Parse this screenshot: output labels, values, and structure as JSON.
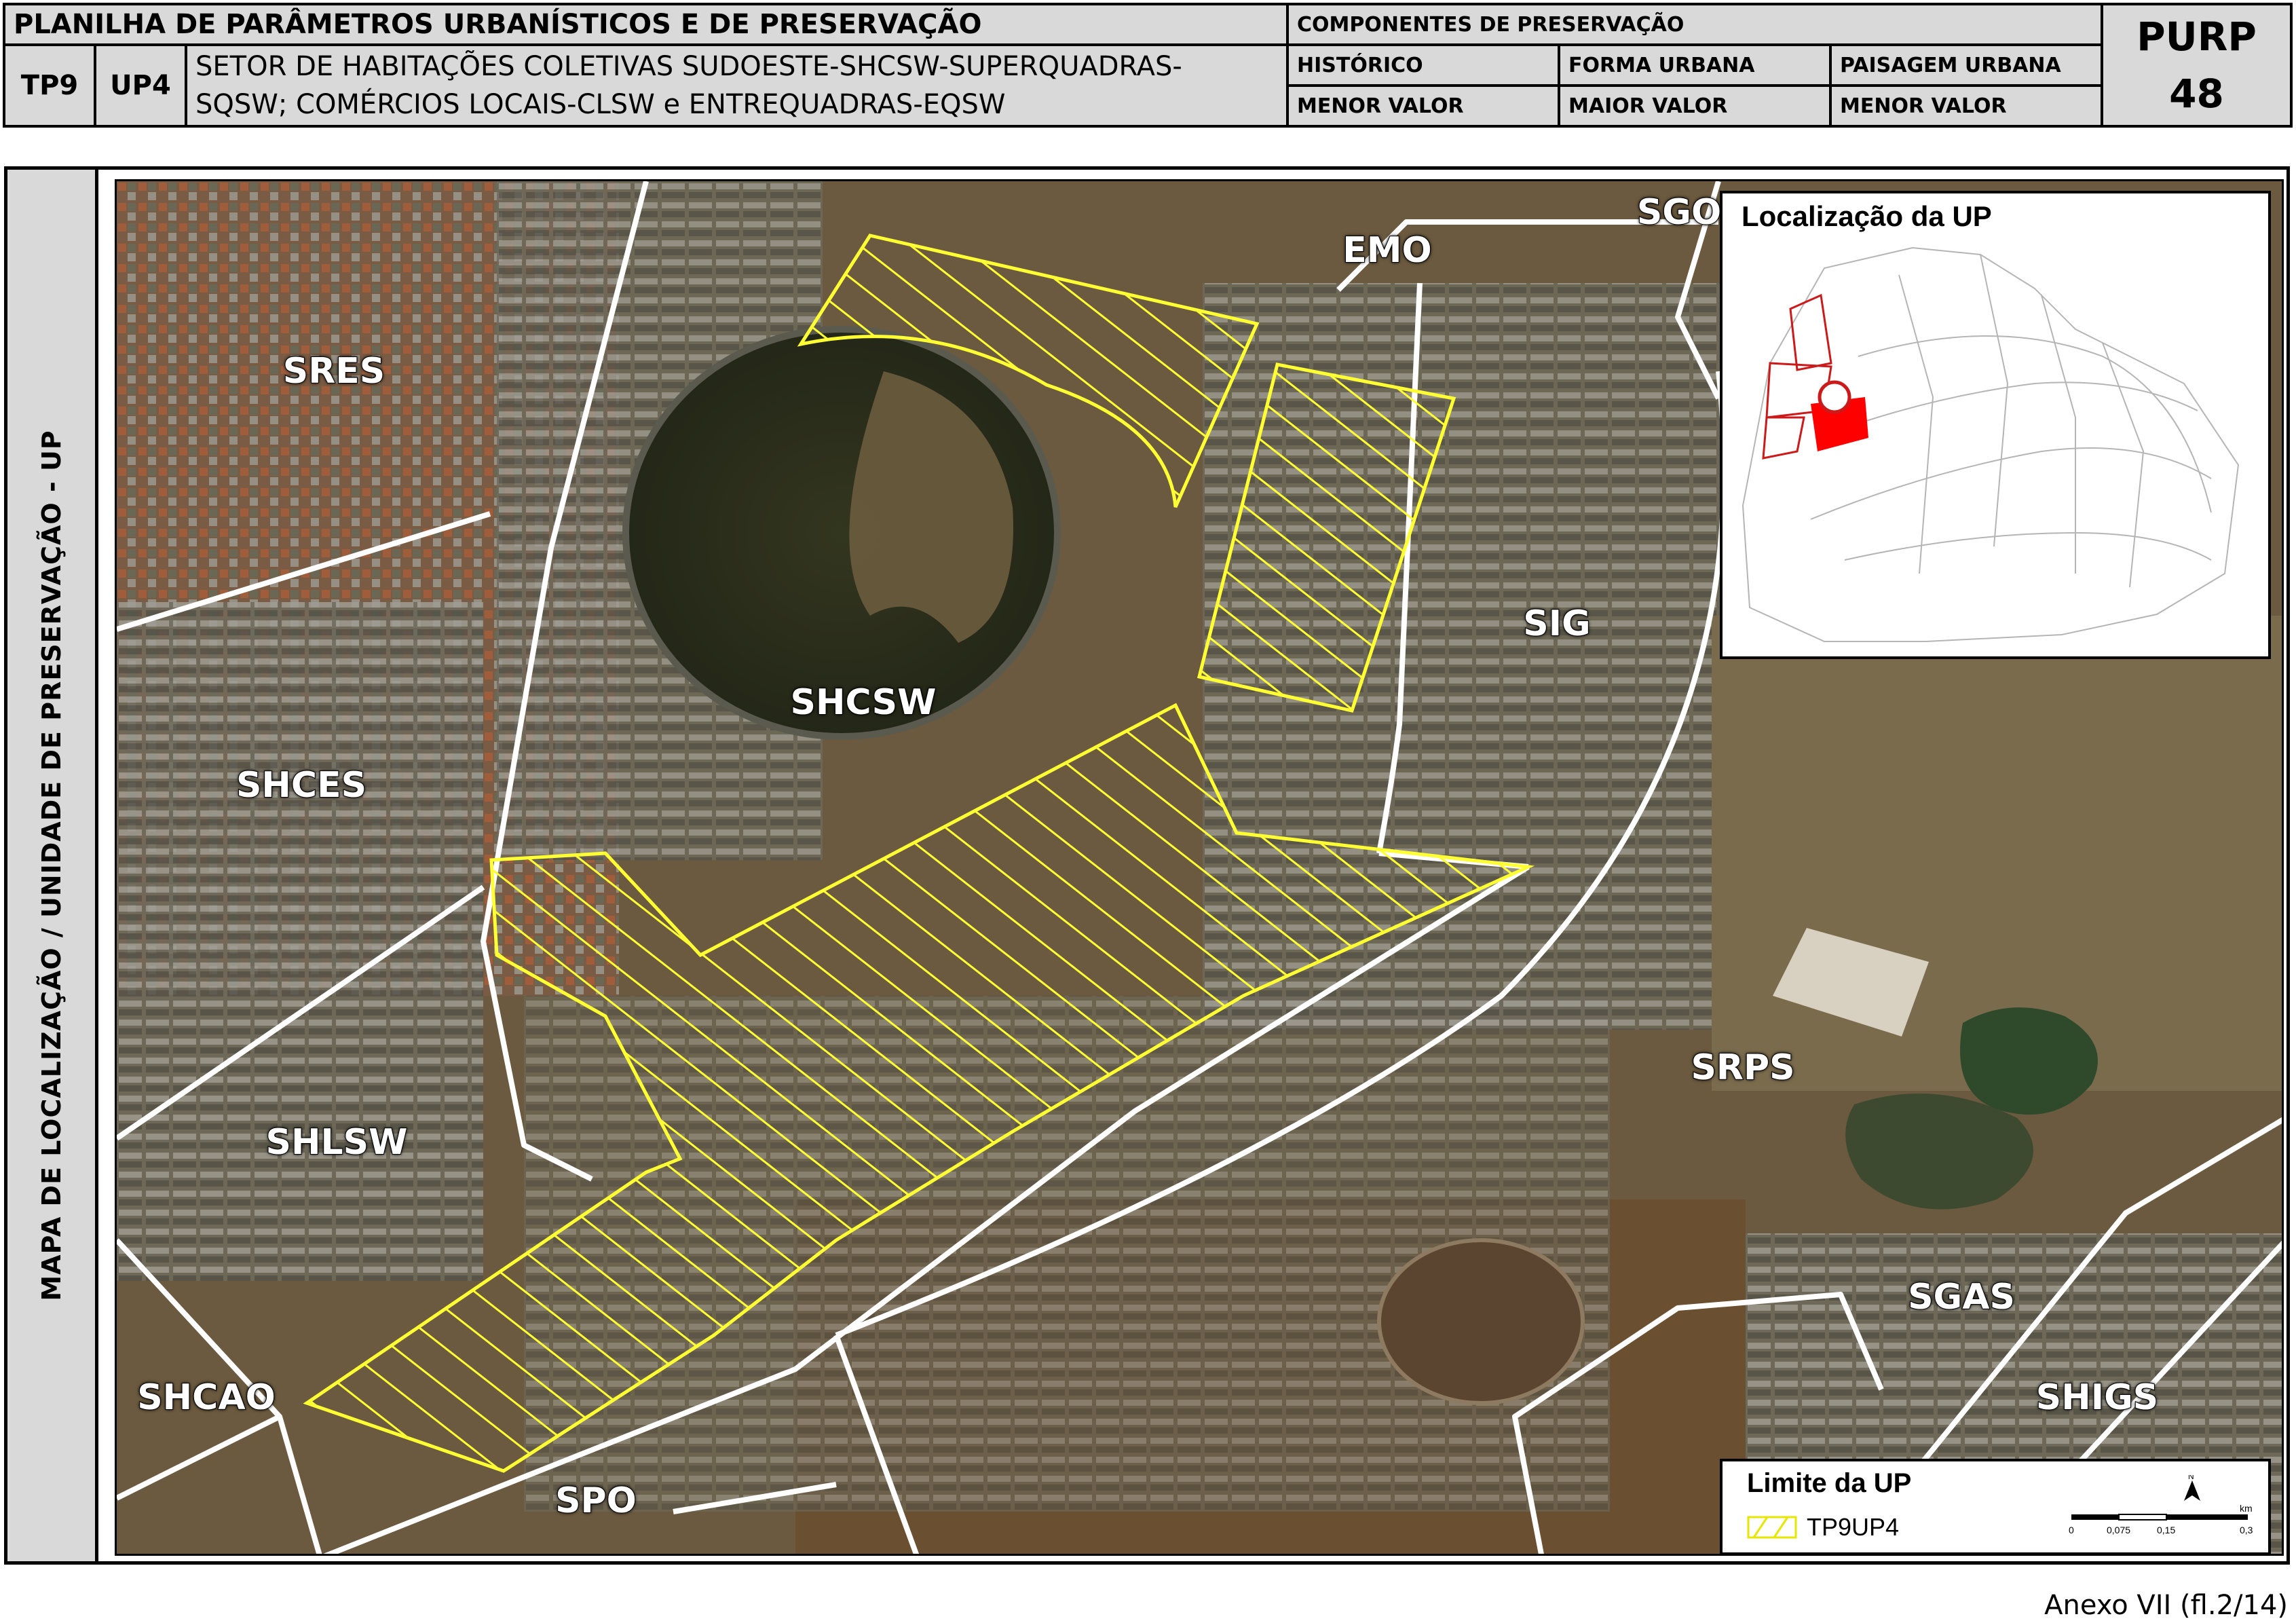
{
  "header": {
    "title": "PLANILHA DE PARÂMETROS URBANÍSTICOS E DE PRESERVAÇÃO",
    "tp": "TP9",
    "up": "UP4",
    "sector_line1": "SETOR DE HABITAÇÕES COLETIVAS SUDOESTE-SHCSW-SUPERQUADRAS-",
    "sector_line2": "SQSW; COMÉRCIOS LOCAIS-CLSW e ENTREQUADRAS-EQSW",
    "components_title": "COMPONENTES DE PRESERVAÇÃO",
    "components": [
      {
        "name": "HISTÓRICO",
        "value": "MENOR VALOR"
      },
      {
        "name": "FORMA URBANA",
        "value": "MAIOR VALOR"
      },
      {
        "name": "PAISAGEM URBANA",
        "value": "MENOR VALOR"
      }
    ],
    "purp_label": "PURP",
    "purp_number": "48"
  },
  "side_label": "MAPA DE LOCALIZAÇÃO / UNIDADE DE PRESERVAÇÃO - UP",
  "map": {
    "sector_labels": [
      "SRES",
      "SHCES",
      "SHLSW",
      "SHCAO",
      "SHCSW",
      "SPO",
      "EMO",
      "SGO",
      "SIG",
      "SRPS",
      "SGAS",
      "SHIGS"
    ],
    "hatch_color": "#ffff33",
    "boundary_color": "#ffffff"
  },
  "inset": {
    "title": "Localização da UP",
    "highlight_color": "#ff0000"
  },
  "legend": {
    "title": "Limite da UP",
    "item": "TP9UP4",
    "north": "N",
    "scale_ticks": [
      "0",
      "0,075",
      "0,15",
      "0,3"
    ],
    "scale_unit": "km"
  },
  "footer": "Anexo VII (fl.2/14)"
}
